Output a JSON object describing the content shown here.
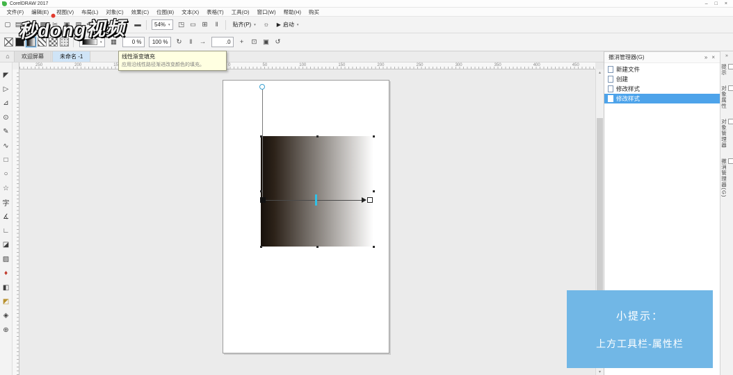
{
  "titlebar": {
    "title": "CorelDRAW 2017",
    "window_controls": [
      {
        "name": "minimize-button",
        "glyph": "–"
      },
      {
        "name": "maximize-button",
        "glyph": "□"
      },
      {
        "name": "close-button",
        "glyph": "×"
      }
    ]
  },
  "menubar": {
    "items": [
      "文件(F)",
      "编辑(E)",
      "视图(V)",
      "布局(L)",
      "对象(C)",
      "效果(C)",
      "位图(B)",
      "文本(X)",
      "表格(T)",
      "工具(O)",
      "窗口(W)",
      "帮助(H)",
      "购买"
    ]
  },
  "std_toolbar": {
    "icons_left": [
      {
        "name": "new-document-button",
        "glyph": "▢"
      },
      {
        "name": "open-button",
        "glyph": "▤",
        "caret": true
      },
      {
        "name": "save-button",
        "glyph": "▦"
      },
      {
        "name": "print-button",
        "glyph": "▩"
      },
      {
        "name": "cut-button",
        "glyph": "✂"
      },
      {
        "name": "copy-button",
        "glyph": "▣"
      },
      {
        "name": "paste-button",
        "glyph": "▧"
      },
      {
        "name": "undo-button",
        "glyph": "↶",
        "caret": true
      },
      {
        "name": "redo-button",
        "glyph": "↷",
        "caret": true
      },
      {
        "name": "import-button",
        "glyph": "↧"
      },
      {
        "name": "export-button",
        "glyph": "↥"
      },
      {
        "name": "publish-pdf-button",
        "glyph": "▬"
      }
    ],
    "zoom_value": "54%",
    "icons_right": [
      {
        "name": "fullscreen-preview-button",
        "glyph": "◳"
      },
      {
        "name": "show-rulers-button",
        "glyph": "▭"
      },
      {
        "name": "show-grid-button",
        "glyph": "⊞"
      },
      {
        "name": "show-guidelines-button",
        "glyph": "‖"
      }
    ],
    "snap_label": "贴齐(P)",
    "options_glyph": "☼",
    "launch_glyph": "▶",
    "launch_label": "启动"
  },
  "prop_bar": {
    "fill_chips": [
      {
        "name": "no-fill-button",
        "type": "nofill"
      },
      {
        "name": "uniform-fill-button",
        "type": "solid"
      },
      {
        "name": "fountain-fill-button",
        "type": "gradient",
        "active": true
      },
      {
        "name": "vector-pattern-fill-button",
        "type": "pattern"
      },
      {
        "name": "bitmap-pattern-fill-button",
        "type": "checker"
      },
      {
        "name": "texture-fill-button",
        "type": "texture"
      }
    ],
    "edit_fill_glyph": "▦",
    "fields": {
      "stop_opacity": "0 %",
      "transparency": "100 %",
      "angle": ".0"
    },
    "plus_glyph": "+",
    "icons_mid": [
      {
        "name": "rotate-fill-button",
        "glyph": "↻"
      },
      {
        "name": "freeze-fill-button",
        "glyph": "‖"
      },
      {
        "name": "fill-direction-button",
        "glyph": "→"
      }
    ],
    "icons_end": [
      {
        "name": "smooth-fill-button",
        "glyph": "⊡"
      },
      {
        "name": "copy-fill-button",
        "glyph": "▣"
      },
      {
        "name": "reset-fill-button",
        "glyph": "↺"
      }
    ]
  },
  "tooltip": {
    "title": "线性渐变填充",
    "desc": "应用沿线性路径渐进改变颜色的填充。"
  },
  "watermark": {
    "text": "秒dong视频"
  },
  "doc_tabs": {
    "home_glyph": "⌂",
    "tabs": [
      {
        "label": "欢迎屏幕"
      },
      {
        "label": "未命名 -1",
        "active": true
      }
    ]
  },
  "ruler": {
    "h_numbers": [
      "250",
      "200",
      "150",
      "100",
      "50",
      "0",
      "50",
      "100",
      "150",
      "200",
      "250",
      "300",
      "350",
      "400",
      "450"
    ]
  },
  "toolbox": {
    "tools": [
      {
        "name": "pick-tool",
        "glyph": "◤"
      },
      {
        "name": "shape-tool",
        "glyph": "▷"
      },
      {
        "name": "crop-tool",
        "glyph": "⊿"
      },
      {
        "name": "zoom-tool",
        "glyph": "⊙"
      },
      {
        "name": "freehand-tool",
        "glyph": "✎"
      },
      {
        "name": "artistic-media-tool",
        "glyph": "∿"
      },
      {
        "name": "rectangle-tool",
        "glyph": "□"
      },
      {
        "name": "ellipse-tool",
        "glyph": "○"
      },
      {
        "name": "polygon-tool",
        "glyph": "☆"
      },
      {
        "name": "text-tool",
        "glyph": "字"
      },
      {
        "name": "parallel-dimension-tool",
        "glyph": "∡"
      },
      {
        "name": "connector-tool",
        "glyph": "∟"
      },
      {
        "name": "drop-shadow-tool",
        "glyph": "◪"
      },
      {
        "name": "transparency-tool",
        "glyph": "▨"
      },
      {
        "name": "color-eyedropper-tool",
        "glyph": "♦",
        "color": "#c0392b"
      },
      {
        "name": "interactive-fill-tool",
        "glyph": "◧"
      },
      {
        "name": "smart-fill-tool",
        "glyph": "◩",
        "color": "#b8912f"
      },
      {
        "name": "outline-pen-tool",
        "glyph": "◈"
      },
      {
        "name": "more-tools-button",
        "glyph": "⊕"
      }
    ]
  },
  "canvas": {
    "rect_style": "background:linear-gradient(90deg,#17110c 0%,#2c2219 12%,#ffffff 100%)",
    "gradient_from": "#17110c",
    "gradient_to": "#ffffff",
    "midpoint_slider_color": "#2fc1e8"
  },
  "scrollbar": {
    "up_glyph": "▴",
    "down_glyph": "▾"
  },
  "ui_glyphs": {
    "caret": "▾"
  },
  "undo_panel": {
    "title": "撤消管理器(G)",
    "header_icons": [
      {
        "name": "docker-menu-icon",
        "glyph": "»"
      },
      {
        "name": "docker-close-icon",
        "glyph": "×"
      }
    ],
    "items": [
      {
        "label": "新建文件"
      },
      {
        "label": "创建"
      },
      {
        "label": "修改样式"
      },
      {
        "label": "修改样式",
        "selected": true
      }
    ],
    "selection_color": "#4da3ea"
  },
  "dock_strip": {
    "collapse_glyph": "»",
    "tabs": [
      "提示",
      "对象属性",
      "对象管理器",
      "撤消管理器(G)"
    ]
  },
  "tip_box": {
    "line1": "小提示：",
    "line2": "上方工具栏-属性栏",
    "background": "#71b7e6"
  }
}
